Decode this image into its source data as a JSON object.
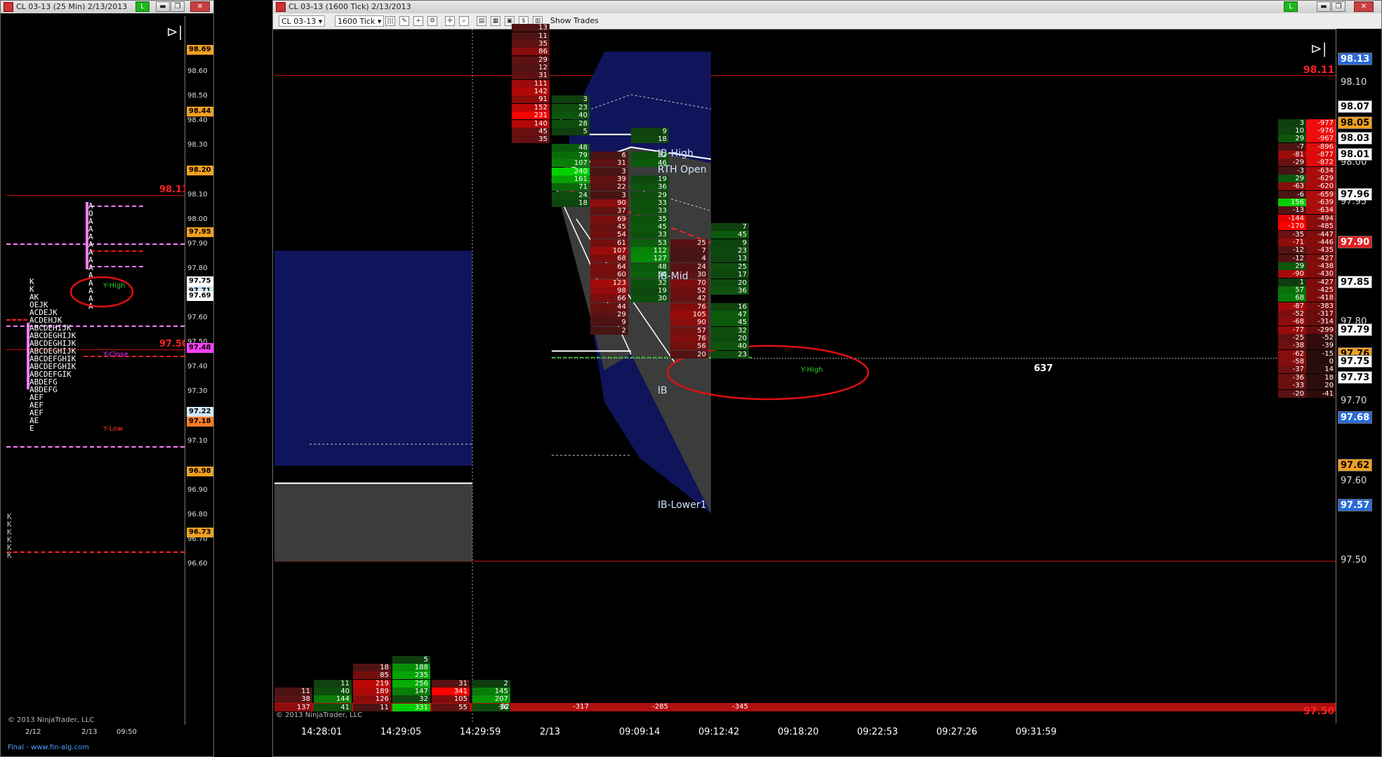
{
  "colors": {
    "bull": "#22b422",
    "bear": "#e01010",
    "profile": "#ff7bff",
    "ib_fill": "#101560",
    "value_area": "#3c3c3c",
    "price_line": "#d01010",
    "accent_orange": "#ffa500"
  },
  "left_window": {
    "title": "CL 03-13 (25 Min)  2/13/2013",
    "link_label": "L",
    "btn_min": "▬",
    "btn_max": "❐",
    "btn_close": "✕",
    "f_label": "F",
    "play_icon": "⊳|",
    "price_ticks": [
      "98.60",
      "98.50",
      "98.40",
      "98.30",
      "98.10",
      "98.00",
      "97.90",
      "97.80",
      "97.60",
      "97.50",
      "97.40",
      "97.30",
      "97.10",
      "96.90",
      "96.80",
      "96.70",
      "96.60"
    ],
    "tags": [
      {
        "text": "98.69",
        "color": "#f0a020"
      },
      {
        "text": "98.44",
        "color": "#f0a020"
      },
      {
        "text": "98.20",
        "color": "#f0a020"
      },
      {
        "text": "97.95",
        "color": "#f0a020"
      },
      {
        "text": "97.75",
        "color": "#ffffff"
      },
      {
        "text": "97.71",
        "color": "#cfe8ff"
      },
      {
        "text": "97.69",
        "color": "#ffffff"
      },
      {
        "text": "97.48",
        "color": "#ff40ff"
      },
      {
        "text": "97.22",
        "color": "#cfe8ff"
      },
      {
        "text": "97.18",
        "color": "#ff7a2a"
      },
      {
        "text": "96.98",
        "color": "#f0a020"
      },
      {
        "text": "96.73",
        "color": "#f0a020"
      }
    ],
    "red_labels": [
      {
        "text": "98.11"
      },
      {
        "text": "97.50"
      }
    ],
    "tpo_left": [
      "K",
      "K",
      "AK",
      "OEJK",
      "ACDEJK",
      "ACDEHJK",
      "ABCDEHIJK",
      "ABCDEGHIJK",
      "ABCDEGHIJK",
      "ABCDEGHIJK",
      "ABCDEFGHIK",
      "ABCDEFGHIK",
      "ABCDEFGIK",
      "ABDEFG",
      "ABDEFG",
      "AEF",
      "AEF",
      "AEF",
      "AE",
      "E"
    ],
    "tpo_right": [
      "A",
      "O",
      "A",
      "A",
      "A",
      "A",
      "A",
      "A",
      "A",
      "A",
      "A",
      "A",
      "A",
      "A"
    ],
    "annotations": {
      "y_high": "Y-High",
      "y_close": "Y-Close",
      "y_low": "Y-Low"
    },
    "k_letters": [
      "K",
      "K",
      "K",
      "K",
      "K",
      "K"
    ],
    "time_labels": [
      "2/12",
      "2/13",
      "09:50"
    ],
    "copyright": "© 2013 NinjaTrader, LLC",
    "footer": "Final - www.fin-alg.com"
  },
  "right_window": {
    "title": "CL 03-13 (1600 Tick)  2/13/2013",
    "link_label": "L",
    "btn_min": "▬",
    "btn_max": "❐",
    "btn_close": "✕",
    "toolbar": {
      "instrument": "CL 03-13",
      "period": "1600 Tick",
      "show_trades": "Show Trades"
    },
    "f_label": "F",
    "play_icon": "⊳|",
    "price_ticks": [
      "98.10",
      "98.00",
      "97.80",
      "97.70",
      "97.60",
      "97.50"
    ],
    "tags": [
      {
        "text": "98.13",
        "color": "#2a6ad8"
      },
      {
        "text": "98.07",
        "color": "#ffffff"
      },
      {
        "text": "98.05",
        "color": "#f0a020"
      },
      {
        "text": "98.03",
        "color": "#ffffff"
      },
      {
        "text": "98.01",
        "color": "#ffffff"
      },
      {
        "text": "97.96",
        "color": "#ffffff"
      },
      {
        "text": "97.95",
        "color": "#ffffff"
      },
      {
        "text": "97.90",
        "color": "#e02020"
      },
      {
        "text": "97.85",
        "color": "#ffffff"
      },
      {
        "text": "97.79",
        "color": "#ffffff"
      },
      {
        "text": "97.76",
        "color": "#f0a020"
      },
      {
        "text": "97.75",
        "color": "#ffffff"
      },
      {
        "text": "97.73",
        "color": "#ffffff"
      },
      {
        "text": "97.68",
        "color": "#2a6ad8"
      },
      {
        "text": "97.62",
        "color": "#f0a020"
      },
      {
        "text": "97.57",
        "color": "#2a6ad8"
      }
    ],
    "red_labels": [
      {
        "text": "98.11"
      },
      {
        "text": "97.50"
      }
    ],
    "level_labels": [
      "IB-High",
      "RTH Open",
      "IB-Mid",
      "IB",
      "IB-Lower1"
    ],
    "time_labels": [
      "14:28:01",
      "14:29:05",
      "14:29:59",
      "2/13",
      "09:09:14",
      "09:12:42",
      "09:18:20",
      "09:22:53",
      "09:27:26",
      "09:31:59"
    ],
    "y_high": "Y-High",
    "last_count": "637",
    "bottom_deltas": [
      "-82",
      "-317",
      "-285",
      "-345"
    ],
    "copyright": "© 2013 NinjaTrader, LLC",
    "ladder": {
      "vol": [
        "3",
        "10",
        "29",
        "-7",
        "-81",
        "-29",
        "-3",
        "29",
        "-63",
        "-6",
        "156",
        "-13",
        "-144",
        "-170",
        "-35",
        "-71",
        "-12",
        "-12",
        "29",
        "-90",
        "1",
        "57",
        "68",
        "-87",
        "-52",
        "-68",
        "-77",
        "-25",
        "-38",
        "-62",
        "-58",
        "-37",
        "-36",
        "-33",
        "-20"
      ],
      "cum": [
        "-977",
        "-976",
        "-967",
        "-896",
        "-877",
        "-872",
        "-634",
        "-629",
        "-620",
        "-659",
        "-639",
        "-634",
        "-494",
        "-485",
        "-447",
        "-446",
        "-435",
        "-427",
        "-438",
        "-430",
        "-427",
        "-425",
        "-418",
        "-383",
        "-317",
        "-314",
        "-299",
        "-52",
        "-39",
        "-15",
        "0",
        "14",
        "18",
        "20",
        "-41"
      ]
    },
    "footprints": [
      {
        "rows": [
          [
            "13",
            ""
          ],
          [
            "11",
            ""
          ],
          [
            "35",
            ""
          ],
          [
            "86",
            ""
          ],
          [
            "29",
            ""
          ],
          [
            "12",
            ""
          ],
          [
            "31",
            ""
          ],
          [
            "111",
            ""
          ],
          [
            "142",
            ""
          ],
          [
            "91",
            ""
          ],
          [
            "152",
            ""
          ],
          [
            "231",
            ""
          ],
          [
            "140",
            ""
          ],
          [
            "45",
            ""
          ],
          [
            "35",
            ""
          ]
        ]
      },
      {
        "rows": [
          [
            "",
            "3"
          ],
          [
            "",
            "23"
          ],
          [
            "",
            "40"
          ],
          [
            "",
            "28"
          ],
          [
            "",
            "5"
          ],
          [
            "",
            ""
          ],
          [
            "",
            "48"
          ],
          [
            "",
            "79"
          ],
          [
            "",
            "107"
          ],
          [
            "",
            "240"
          ],
          [
            "",
            "161"
          ],
          [
            "",
            "71"
          ],
          [
            "",
            "24"
          ],
          [
            "",
            "18"
          ]
        ]
      },
      {
        "rows": [
          [
            "6",
            ""
          ],
          [
            "31",
            ""
          ],
          [
            "3",
            ""
          ],
          [
            "39",
            ""
          ],
          [
            "22",
            ""
          ],
          [
            "3",
            ""
          ],
          [
            "90",
            ""
          ],
          [
            "37",
            ""
          ],
          [
            "69",
            ""
          ],
          [
            "45",
            ""
          ],
          [
            "54",
            ""
          ],
          [
            "61",
            ""
          ],
          [
            "107",
            ""
          ],
          [
            "68",
            ""
          ],
          [
            "64",
            ""
          ],
          [
            "60",
            ""
          ],
          [
            "123",
            ""
          ],
          [
            "98",
            ""
          ],
          [
            "66",
            ""
          ],
          [
            "44",
            ""
          ],
          [
            "29",
            ""
          ],
          [
            "9",
            ""
          ],
          [
            "2",
            ""
          ]
        ]
      },
      {
        "rows": [
          [
            "",
            "9"
          ],
          [
            "",
            "18"
          ],
          [
            "",
            ""
          ],
          [
            "",
            "32"
          ],
          [
            "",
            "46"
          ],
          [
            "",
            ""
          ],
          [
            "",
            "19"
          ],
          [
            "",
            "36"
          ],
          [
            "",
            "29"
          ],
          [
            "",
            "33"
          ],
          [
            "",
            "33"
          ],
          [
            "",
            "35"
          ],
          [
            "",
            "45"
          ],
          [
            "",
            "33"
          ],
          [
            "",
            "53"
          ],
          [
            "",
            "112"
          ],
          [
            "",
            "127"
          ],
          [
            "",
            "48"
          ],
          [
            "",
            "56"
          ],
          [
            "",
            "32"
          ],
          [
            "",
            "19"
          ],
          [
            "",
            "30"
          ]
        ]
      },
      {
        "rows": [
          [
            "25",
            ""
          ],
          [
            "7",
            ""
          ],
          [
            "4",
            ""
          ],
          [
            "24",
            ""
          ],
          [
            "30",
            ""
          ],
          [
            "70",
            ""
          ],
          [
            "52",
            ""
          ],
          [
            "42",
            ""
          ],
          [
            "76",
            ""
          ],
          [
            "105",
            ""
          ],
          [
            "90",
            ""
          ],
          [
            "57",
            ""
          ],
          [
            "76",
            ""
          ],
          [
            "56",
            ""
          ],
          [
            "20",
            ""
          ]
        ]
      },
      {
        "rows": [
          [
            "",
            "7"
          ],
          [
            "",
            "45"
          ],
          [
            "",
            "9"
          ],
          [
            "",
            "23"
          ],
          [
            "",
            "13"
          ],
          [
            "",
            "25"
          ],
          [
            "",
            "17"
          ],
          [
            "",
            "20"
          ],
          [
            "",
            "36"
          ],
          [
            "",
            ""
          ],
          [
            "",
            "16"
          ],
          [
            "",
            "47"
          ],
          [
            "",
            "45"
          ],
          [
            "",
            "32"
          ],
          [
            "",
            "20"
          ],
          [
            "",
            "40"
          ],
          [
            "",
            "23"
          ]
        ]
      }
    ],
    "early_bars": [
      {
        "rows": [
          "11",
          "38",
          "137"
        ]
      },
      {
        "rows": [
          "11",
          "40",
          "144",
          "41"
        ]
      },
      {
        "rows": [
          "18",
          "85",
          "219",
          "189",
          "126",
          "11"
        ]
      },
      {
        "rows": [
          "5",
          "188",
          "235",
          "256",
          "147",
          "32",
          "331"
        ]
      },
      {
        "rows": [
          "31",
          "341",
          "105",
          "55"
        ]
      },
      {
        "rows": [
          "2",
          "145",
          "207",
          "36"
        ]
      }
    ]
  }
}
